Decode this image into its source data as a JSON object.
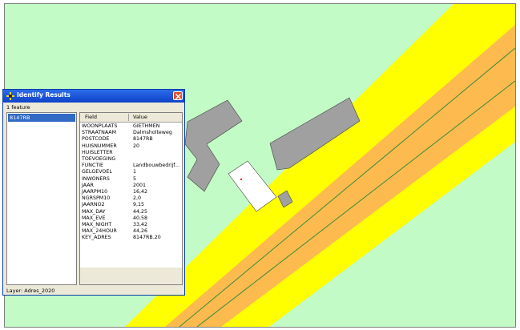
{
  "window": {
    "title": "Identify Results",
    "icon": "identify-icon",
    "close_icon": "close-icon"
  },
  "feature_count": "1 feature",
  "features": [
    "8147RB"
  ],
  "table": {
    "headers": {
      "field": "Field",
      "value": "Value"
    },
    "rows": [
      {
        "field": "WOONPLAATS",
        "value": "GIETHMEN"
      },
      {
        "field": "STRAATNAAM",
        "value": "Dalmsholteweg"
      },
      {
        "field": "POSTCODE",
        "value": "8147RB"
      },
      {
        "field": "HUISNUMMER",
        "value": "20"
      },
      {
        "field": "HUISLETTER",
        "value": ""
      },
      {
        "field": "TOEVOEGING",
        "value": ""
      },
      {
        "field": "FUNCTIE",
        "value": "Landbouwbedrijf..."
      },
      {
        "field": "GELGEVOEL",
        "value": "1"
      },
      {
        "field": "INWONERS",
        "value": "5"
      },
      {
        "field": "JAAR",
        "value": "2001"
      },
      {
        "field": "JAARPM10",
        "value": "16,42"
      },
      {
        "field": "NGRSPM10",
        "value": "2,0"
      },
      {
        "field": "JAARNO2",
        "value": "9,15"
      },
      {
        "field": "MAX_DAY",
        "value": "44,25"
      },
      {
        "field": "MAX_EVE",
        "value": "40,58"
      },
      {
        "field": "MAX_NIGHT",
        "value": "33,42"
      },
      {
        "field": "MAX_24HOUR",
        "value": "44,26"
      },
      {
        "field": "KEY_ADRES",
        "value": "8147RB.20"
      }
    ]
  },
  "layer_label": "Layer: Adres_2020",
  "colors": {
    "map_background": "#c3fbc6",
    "zone_yellow": "#ffff00",
    "zone_orange": "#fdbb4f",
    "road_line": "#3a8a3a",
    "building": "#a0a0a0",
    "selected_building": "#ffffff",
    "selection_point": "#ff0000",
    "titlebar": "#1a55d6",
    "selection_highlight": "#316ac5"
  }
}
